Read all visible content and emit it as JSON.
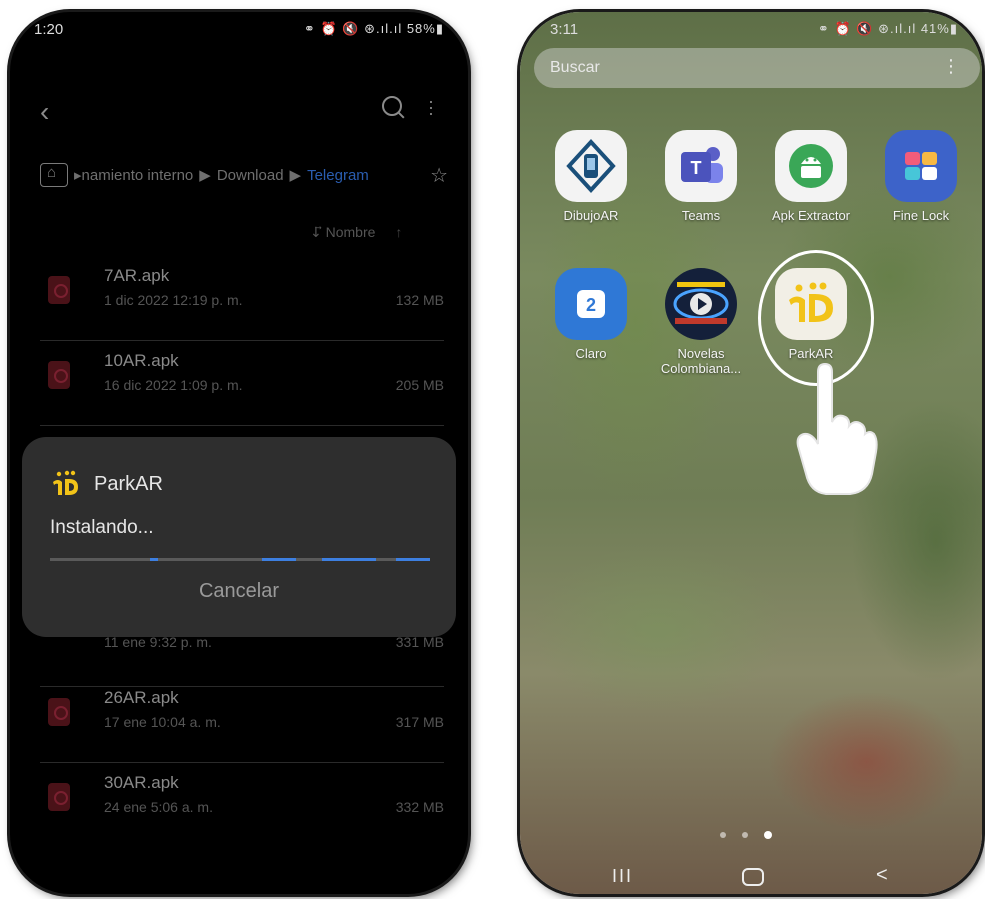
{
  "left_phone": {
    "status": {
      "time": "1:20",
      "icons": "⚭ ⏰ 🔇 ⊛.ıl.ıl 58%▮"
    },
    "breadcrumb": {
      "part1": "▸namiento interno",
      "sep1": "▶",
      "part2": "Download",
      "sep2": "▶",
      "active": "Telegram"
    },
    "sort_label": "↓⃗ Nombre",
    "sort_up": "↑",
    "files": [
      {
        "name": "7AR.apk",
        "date": "1 dic 2022 12:19 p. m.",
        "size": "132 MB"
      },
      {
        "name": "10AR.apk",
        "date": "16 dic 2022 1:09 p. m.",
        "size": "205 MB"
      },
      {
        "name": "",
        "date": "11 ene 9:32 p. m.",
        "size": "331 MB"
      },
      {
        "name": "26AR.apk",
        "date": "17 ene 10:04 a. m.",
        "size": "317 MB"
      },
      {
        "name": "30AR.apk",
        "date": "24 ene 5:06 a. m.",
        "size": "332 MB"
      }
    ],
    "dialog": {
      "title": "ParkAR",
      "status": "Instalando...",
      "cancel": "Cancelar",
      "progress_color": "#3d7fe0"
    }
  },
  "right_phone": {
    "status": {
      "time": "3:11",
      "icons": "⚭ ⏰ 🔇 ⊛.ıl.ıl 41%▮"
    },
    "search_placeholder": "Buscar",
    "search_menu": "⋮",
    "apps": [
      {
        "label": "DibujoAR",
        "icon": "dibujoar-icon"
      },
      {
        "label": "Teams",
        "icon": "teams-icon"
      },
      {
        "label": "Apk Extractor",
        "icon": "android-icon"
      },
      {
        "label": "Fine Lock",
        "icon": "finelock-icon"
      },
      {
        "label": "Claro",
        "icon": "claro-icon"
      },
      {
        "label": "Novelas Colombiana...",
        "icon": "novelas-icon"
      },
      {
        "label": "ParkAR",
        "icon": "parkar-icon"
      }
    ],
    "page_indicator": {
      "count": 3,
      "active": 3
    },
    "nav": {
      "recent": "III",
      "back": "<"
    }
  }
}
